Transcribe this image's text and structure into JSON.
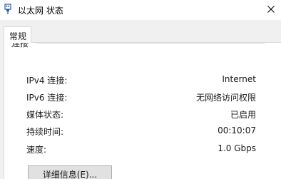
{
  "window": {
    "title": "以太网 状态",
    "title_icon": "ethernet-plug-icon",
    "close_icon": "close-icon"
  },
  "tabs": [
    {
      "label": "常规",
      "selected": true
    }
  ],
  "connection": {
    "group_label": "连接",
    "rows": [
      {
        "label": "IPv4 连接:",
        "value": "Internet"
      },
      {
        "label": "IPv6 连接:",
        "value": "无网络访问权限"
      },
      {
        "label": "媒体状态:",
        "value": "已启用"
      },
      {
        "label": "持续时间:",
        "value": "00:10:07"
      },
      {
        "label": "速度:",
        "value": "1.0 Gbps"
      }
    ]
  },
  "buttons": {
    "details_label": "详细信息(E)..."
  },
  "colors": {
    "dialog_background": "#f0f0f0",
    "panel_background": "#ffffff",
    "button_background": "#e1e1e1",
    "button_border": "#adadad"
  }
}
